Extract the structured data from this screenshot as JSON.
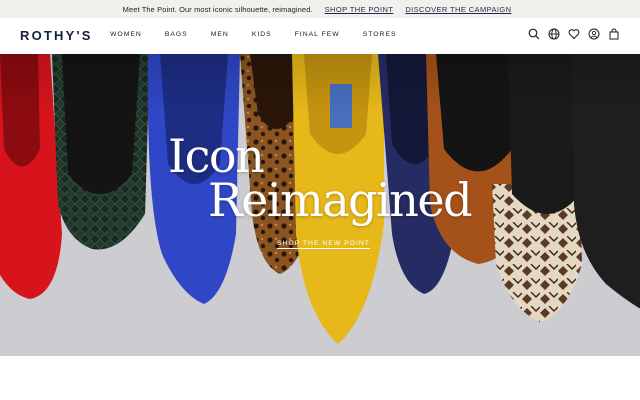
{
  "announcement": {
    "message": "Meet The Point. Our most iconic silhouette, reimagined.",
    "links": [
      "SHOP THE POINT",
      "DISCOVER THE CAMPAIGN"
    ]
  },
  "header": {
    "logo": "ROTHY'S",
    "nav": [
      "WOMEN",
      "BAGS",
      "MEN",
      "KIDS",
      "FINAL FEW",
      "STORES"
    ],
    "icons": [
      "search-icon",
      "globe-icon",
      "heart-icon",
      "account-icon",
      "bag-icon"
    ]
  },
  "hero": {
    "headline_line1": "Icon",
    "headline_line2": "Reimagined",
    "cta": "SHOP THE NEW POINT",
    "shoe_colors": [
      "#d7141c",
      "#203a2c",
      "#2e45c2",
      "#7a4a1c",
      "#e8b91c",
      "#242a5e",
      "#a4501a",
      "#d9cbb6",
      "#1e1e1e"
    ],
    "background_color": "#cfcfd3"
  }
}
